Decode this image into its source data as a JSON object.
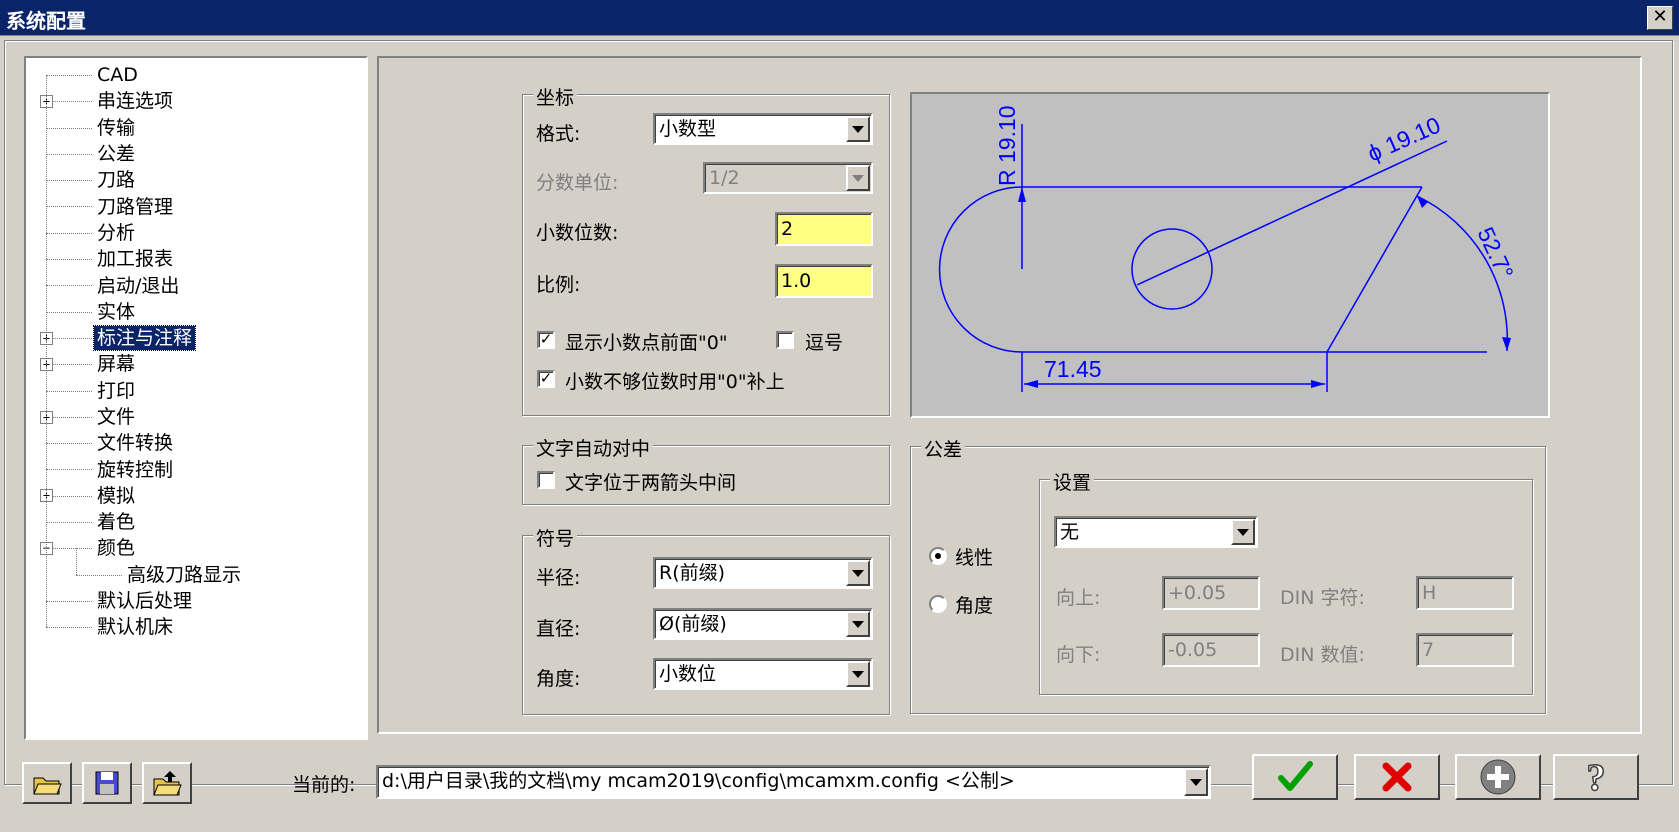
{
  "window": {
    "title": "系统配置",
    "close_glyph": "✕"
  },
  "tree": {
    "items": [
      {
        "label": "CAD",
        "expander": ""
      },
      {
        "label": "串连选项",
        "expander": "+"
      },
      {
        "label": "传输",
        "expander": ""
      },
      {
        "label": "公差",
        "expander": ""
      },
      {
        "label": "刀路",
        "expander": ""
      },
      {
        "label": "刀路管理",
        "expander": ""
      },
      {
        "label": "分析",
        "expander": ""
      },
      {
        "label": "加工报表",
        "expander": ""
      },
      {
        "label": "启动/退出",
        "expander": ""
      },
      {
        "label": "实体",
        "expander": ""
      },
      {
        "label": "标注与注释",
        "expander": "+",
        "selected": true
      },
      {
        "label": "屏幕",
        "expander": "+"
      },
      {
        "label": "打印",
        "expander": ""
      },
      {
        "label": "文件",
        "expander": "+"
      },
      {
        "label": "文件转换",
        "expander": ""
      },
      {
        "label": "旋转控制",
        "expander": ""
      },
      {
        "label": "模拟",
        "expander": "+"
      },
      {
        "label": "着色",
        "expander": ""
      },
      {
        "label": "颜色",
        "expander": "−"
      },
      {
        "label": "高级刀路显示",
        "expander": "",
        "child": true
      },
      {
        "label": "默认后处理",
        "expander": ""
      },
      {
        "label": "默认机床",
        "expander": ""
      }
    ]
  },
  "coords": {
    "legend": "坐标",
    "format_label": "格式:",
    "format_value": "小数型",
    "fraction_label": "分数单位:",
    "fraction_value": "1/2",
    "decimals_label": "小数位数:",
    "decimals_value": "2",
    "scale_label": "比例:",
    "scale_value": "1.0",
    "leading_zero_label": "显示小数点前面\"0\"",
    "leading_zero_checked": true,
    "comma_label": "逗号",
    "comma_checked": false,
    "trailing_zero_label": "小数不够位数时用\"0\"补上",
    "trailing_zero_checked": true
  },
  "preview": {
    "radius_text": "R 19.10",
    "diameter_text": "ϕ 19.10",
    "angle_text": "52.7°",
    "length_text": "71.45",
    "line_color": "#0000ff",
    "bg_color": "#c0c0c0"
  },
  "text_center": {
    "legend": "文字自动对中",
    "label": "文字位于两箭头中间",
    "checked": false
  },
  "symbols": {
    "legend": "符号",
    "radius_label": "半径:",
    "radius_value": "R(前缀)",
    "diameter_label": "直径:",
    "diameter_value": "Ø(前缀)",
    "angle_label": "角度:",
    "angle_value": "小数位"
  },
  "tolerance": {
    "legend": "公差",
    "linear_label": "线性",
    "linear_selected": true,
    "angular_label": "角度",
    "angular_selected": false,
    "settings_legend": "设置",
    "settings_value": "无",
    "upper_label": "向上:",
    "upper_value": "+0.05",
    "lower_label": "向下:",
    "lower_value": "-0.05",
    "din_char_label": "DIN 字符:",
    "din_char_value": "H",
    "din_num_label": "DIN 数值:",
    "din_num_value": "7"
  },
  "bottom": {
    "current_label": "当前的:",
    "current_value": "d:\\用户目录\\我的文档\\my mcam2019\\config\\mcamxm.config <公制>"
  },
  "colors": {
    "ok_green": "#00a000",
    "cancel_red": "#e00000",
    "title_blue": "#0a246a"
  }
}
